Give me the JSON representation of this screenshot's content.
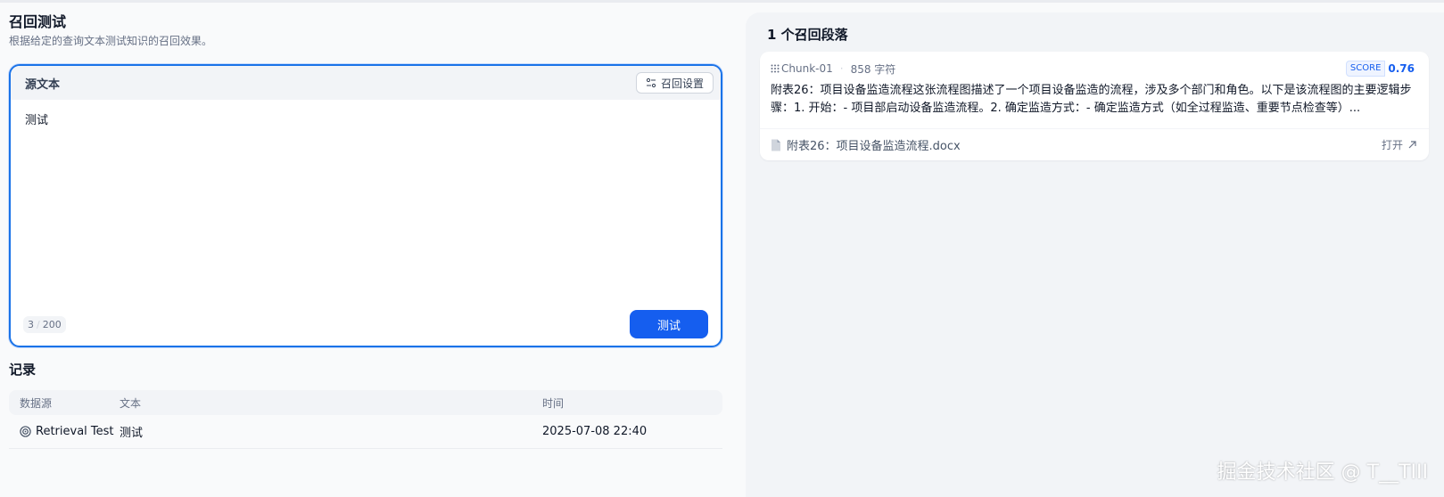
{
  "page": {
    "title": "召回测试",
    "description": "根据给定的查询文本测试知识的召回效果。"
  },
  "editor": {
    "header_title": "源文本",
    "settings_label": "召回设置",
    "text": "测试",
    "char_count": "3",
    "char_limit": "200",
    "char_separator": "/",
    "test_label": "测试"
  },
  "records": {
    "title": "记录",
    "columns": [
      "数据源",
      "文本",
      "时间"
    ],
    "rows": [
      {
        "source": "Retrieval Test",
        "text": "测试",
        "time": "2025-07-08 22:40"
      }
    ]
  },
  "results": {
    "title": "1 个召回段落",
    "chunks": [
      {
        "id": "Chunk-01",
        "chars": "858 字符",
        "score_label": "SCORE",
        "score": "0.76",
        "content": "附表26：项目设备监造流程这张流程图描述了一个项目设备监造的流程，涉及多个部门和角色。以下是该流程图的主要逻辑步骤：1. 开始：- 项目部启动设备监造流程。2. 确定监造方式：- 确定监造方式（如全过程监造、重要节点检查等）...",
        "file": "附表26：项目设备监造流程.docx",
        "open_label": "打开"
      }
    ]
  },
  "watermark": "掘金技术社区 @ T__TIII",
  "colors": {
    "primary": "#155eef",
    "border_focus": "#1a73e8",
    "panel_bg": "#f2f4f7"
  }
}
